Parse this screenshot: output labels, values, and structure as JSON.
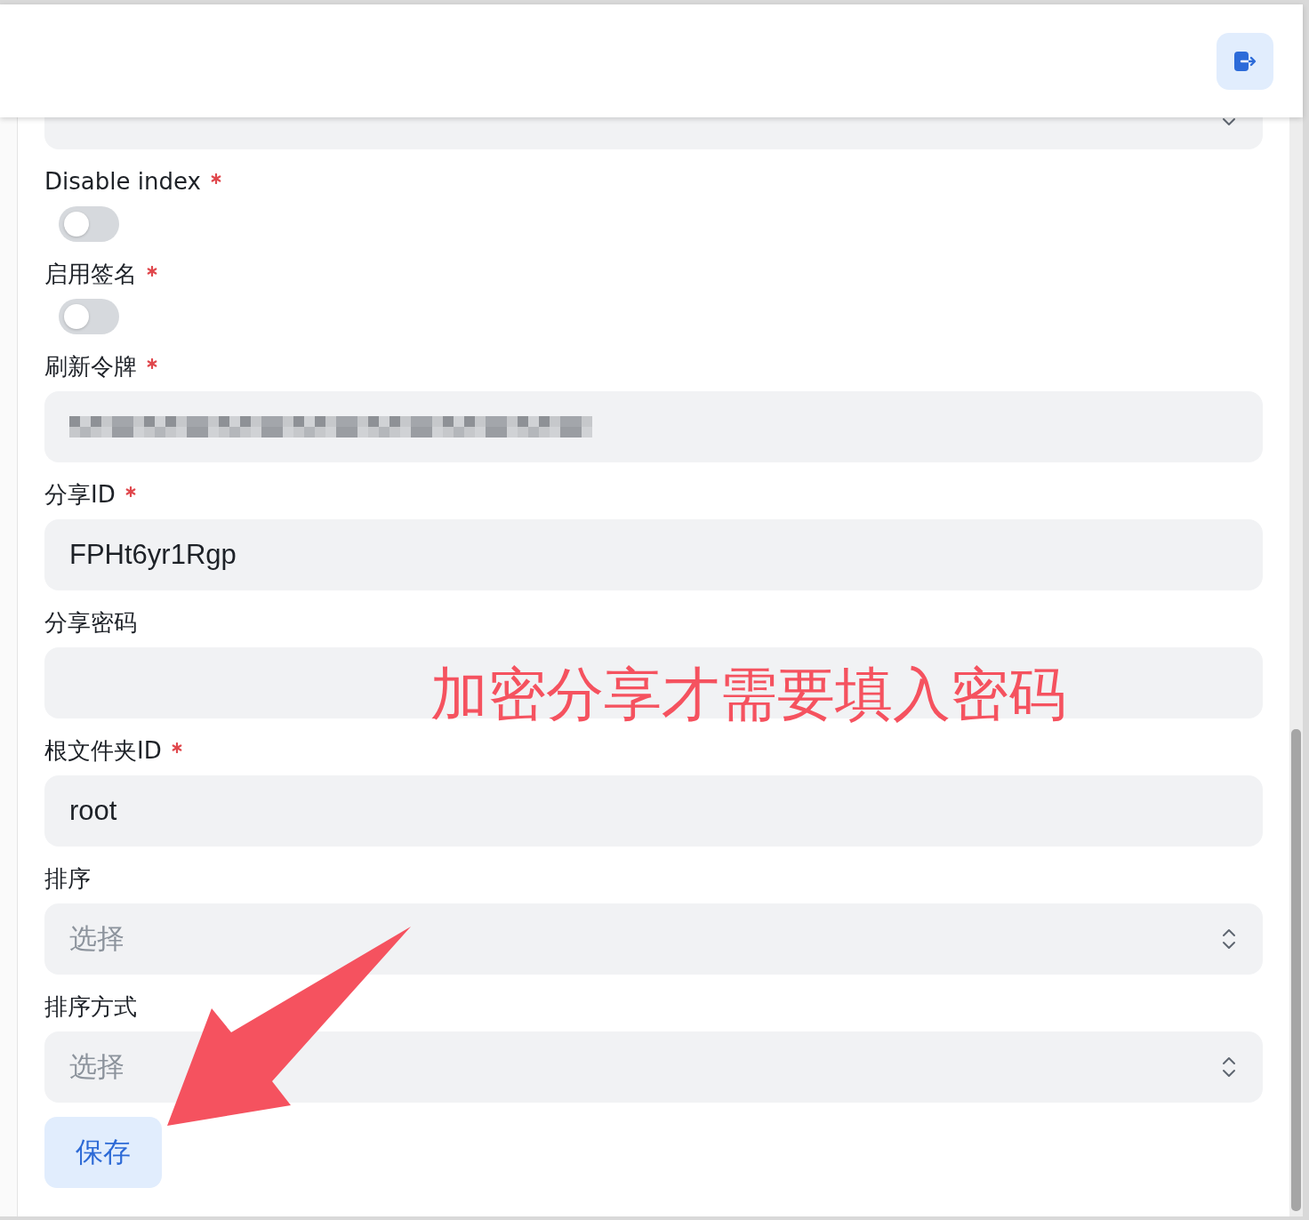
{
  "header": {
    "actions": [
      {
        "kind": "logout"
      }
    ]
  },
  "form": {
    "fields": [
      {
        "kind": "select",
        "clipped": true
      },
      {
        "kind": "switch",
        "label": "Disable index",
        "required": true,
        "on": false
      },
      {
        "kind": "switch",
        "label": "启用签名",
        "required": true,
        "on": false
      },
      {
        "kind": "text",
        "label": "刷新令牌",
        "required": true,
        "redacted": true
      },
      {
        "kind": "text",
        "label": "分享ID",
        "required": true,
        "redacted": false,
        "value": "FPHt6yr1Rgp"
      },
      {
        "kind": "text",
        "label": "分享密码",
        "required": false,
        "redacted": false
      },
      {
        "kind": "text",
        "label": "根文件夹ID",
        "required": true,
        "redacted": false,
        "value": "root"
      },
      {
        "kind": "select",
        "label": "排序",
        "required": false,
        "clipped": false,
        "placeholder": "选择"
      },
      {
        "kind": "select",
        "label": "排序方式",
        "required": false,
        "clipped": false,
        "placeholder": "选择"
      }
    ],
    "save_button": {
      "label": "保存"
    }
  },
  "annotations": [
    {
      "kind": "note",
      "text": "加密分享才需要填入密码"
    },
    {
      "kind": "arrow"
    }
  ]
}
